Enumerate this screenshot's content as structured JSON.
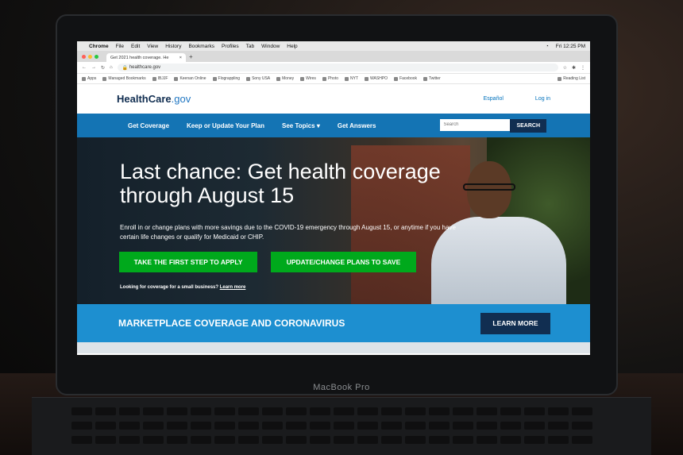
{
  "menubar": {
    "app": "Chrome",
    "items": [
      "File",
      "Edit",
      "View",
      "History",
      "Bookmarks",
      "Profiles",
      "Tab",
      "Window",
      "Help"
    ],
    "clock": "Fri 12:25 PM"
  },
  "browser": {
    "tab_title": "Get 2021 health coverage. He",
    "url": "healthcare.gov",
    "bookmarks": [
      "Apps",
      "Managed Bookmarks",
      "IBJJF",
      "Keenan Online",
      "Flograppling",
      "Sony USA",
      "Money",
      "Wires",
      "Photo",
      "NYT",
      "WASHPO",
      "Facebook",
      "Twitter"
    ],
    "reading_list": "Reading List"
  },
  "site": {
    "logo_main": "HealthCare",
    "logo_gov": ".gov",
    "espanol": "Español",
    "login": "Log in",
    "nav": [
      "Get Coverage",
      "Keep or Update Your Plan",
      "See Topics ▾",
      "Get Answers"
    ],
    "search_placeholder": "Search",
    "search_button": "SEARCH"
  },
  "hero": {
    "headline": "Last chance: Get health coverage through August 15",
    "body": "Enroll in or change plans with more savings due to the COVID-19 emergency through August 15, or anytime if you have certain life changes or qualify for Medicaid or CHIP.",
    "cta_primary": "TAKE THE FIRST STEP TO APPLY",
    "cta_secondary": "UPDATE/CHANGE PLANS TO SAVE",
    "small_business": "Looking for coverage for a small business?",
    "learn_more_link": "Learn more"
  },
  "banner": {
    "title": "MARKETPLACE COVERAGE AND CORONAVIRUS",
    "button": "LEARN MORE"
  },
  "device": {
    "label": "MacBook Pro"
  },
  "colors": {
    "nav_blue": "#1474b4",
    "cta_green": "#00a91c",
    "banner_blue": "#1d8fd0",
    "navy": "#112e51"
  }
}
